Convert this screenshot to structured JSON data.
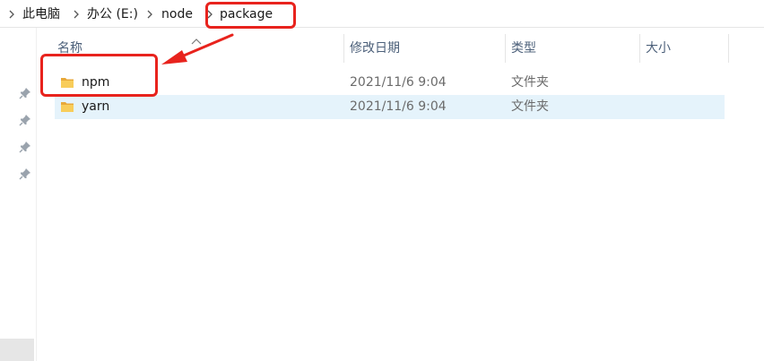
{
  "breadcrumb": {
    "items": [
      {
        "label": "此电脑"
      },
      {
        "label": "办公 (E:)"
      },
      {
        "label": "node"
      },
      {
        "label": "package"
      }
    ]
  },
  "columns": {
    "name": "名称",
    "modified": "修改日期",
    "type": "类型",
    "size": "大小"
  },
  "files": [
    {
      "name": "npm",
      "modified": "2021/11/6 9:04",
      "type": "文件夹",
      "size": ""
    },
    {
      "name": "yarn",
      "modified": "2021/11/6 9:04",
      "type": "文件夹",
      "size": ""
    }
  ],
  "colors": {
    "annotation": "#e8231d",
    "selection": "#e5f3fb",
    "folder": "#f4c04a"
  }
}
